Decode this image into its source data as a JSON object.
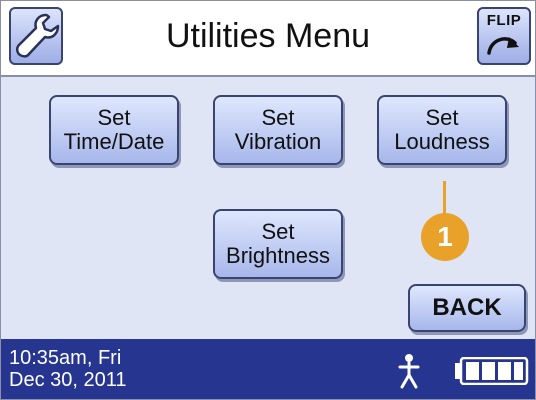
{
  "header": {
    "title": "Utilities Menu",
    "left_icon": "wrench-icon",
    "flip_label": "FLIP"
  },
  "menu": {
    "buttons": [
      {
        "line1": "Set",
        "line2": "Time/Date"
      },
      {
        "line1": "Set",
        "line2": "Vibration"
      },
      {
        "line1": "Set",
        "line2": "Loudness"
      },
      {
        "line1": "Set",
        "line2": "Brightness"
      }
    ],
    "back_label": "BACK"
  },
  "callout": {
    "number": "1"
  },
  "status": {
    "time": "10:35am, Fri",
    "date": "Dec 30, 2011",
    "activity_icon": "person-icon",
    "battery_icon": "battery-icon",
    "battery_level": 1.0
  },
  "colors": {
    "status_bar": "#26358f",
    "button_fill": "#a7b7eb",
    "callout": "#e8a22a",
    "screen_background": "#dfe5f5"
  }
}
